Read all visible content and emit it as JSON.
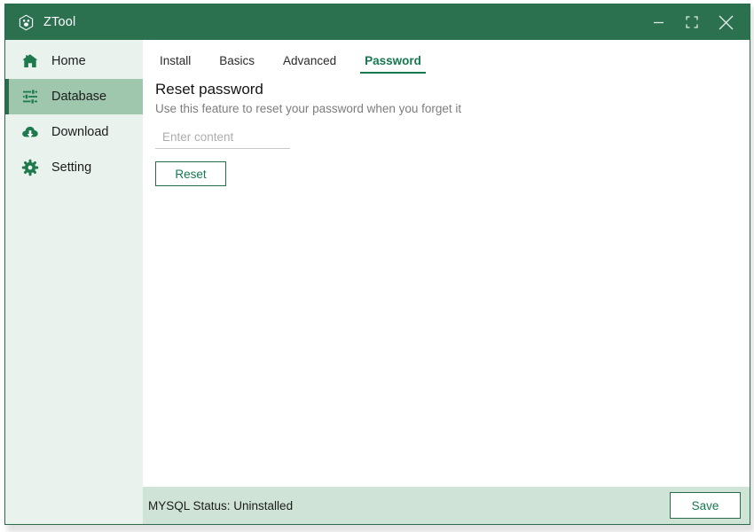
{
  "window": {
    "title": "ZTool",
    "logo_icon": "hexagon-paw-logo-icon",
    "controls": {
      "minimize": "minimize-icon",
      "maximize": "maximize-icon",
      "close": "close-icon"
    }
  },
  "colors": {
    "titlebar_green": "#2b7150",
    "accent_green": "#15794f",
    "border_green": "#2a6b4c",
    "sidebar_bg": "#eaf2ed",
    "sidebar_active_bg": "#9fc7ae",
    "statusbar_bg": "#cfe3d6",
    "content_bg": "#ffffff",
    "muted_text": "#7d7d7d"
  },
  "sidebar": {
    "items": [
      {
        "label": "Home",
        "icon": "home-icon",
        "active": false
      },
      {
        "label": "Database",
        "icon": "sliders-icon",
        "active": true
      },
      {
        "label": "Download",
        "icon": "download-cloud-icon",
        "active": false
      },
      {
        "label": "Setting",
        "icon": "gear-icon",
        "active": false
      }
    ]
  },
  "tabs": [
    {
      "label": "Install",
      "active": false
    },
    {
      "label": "Basics",
      "active": false
    },
    {
      "label": "Advanced",
      "active": false
    },
    {
      "label": "Password",
      "active": true
    }
  ],
  "panel": {
    "title": "Reset password",
    "description": "Use this feature to reset your password when you forget it",
    "input": {
      "value": "",
      "placeholder": "Enter content"
    },
    "reset_button_label": "Reset"
  },
  "statusbar": {
    "status_text": "MYSQL Status: Uninstalled",
    "save_button_label": "Save"
  }
}
